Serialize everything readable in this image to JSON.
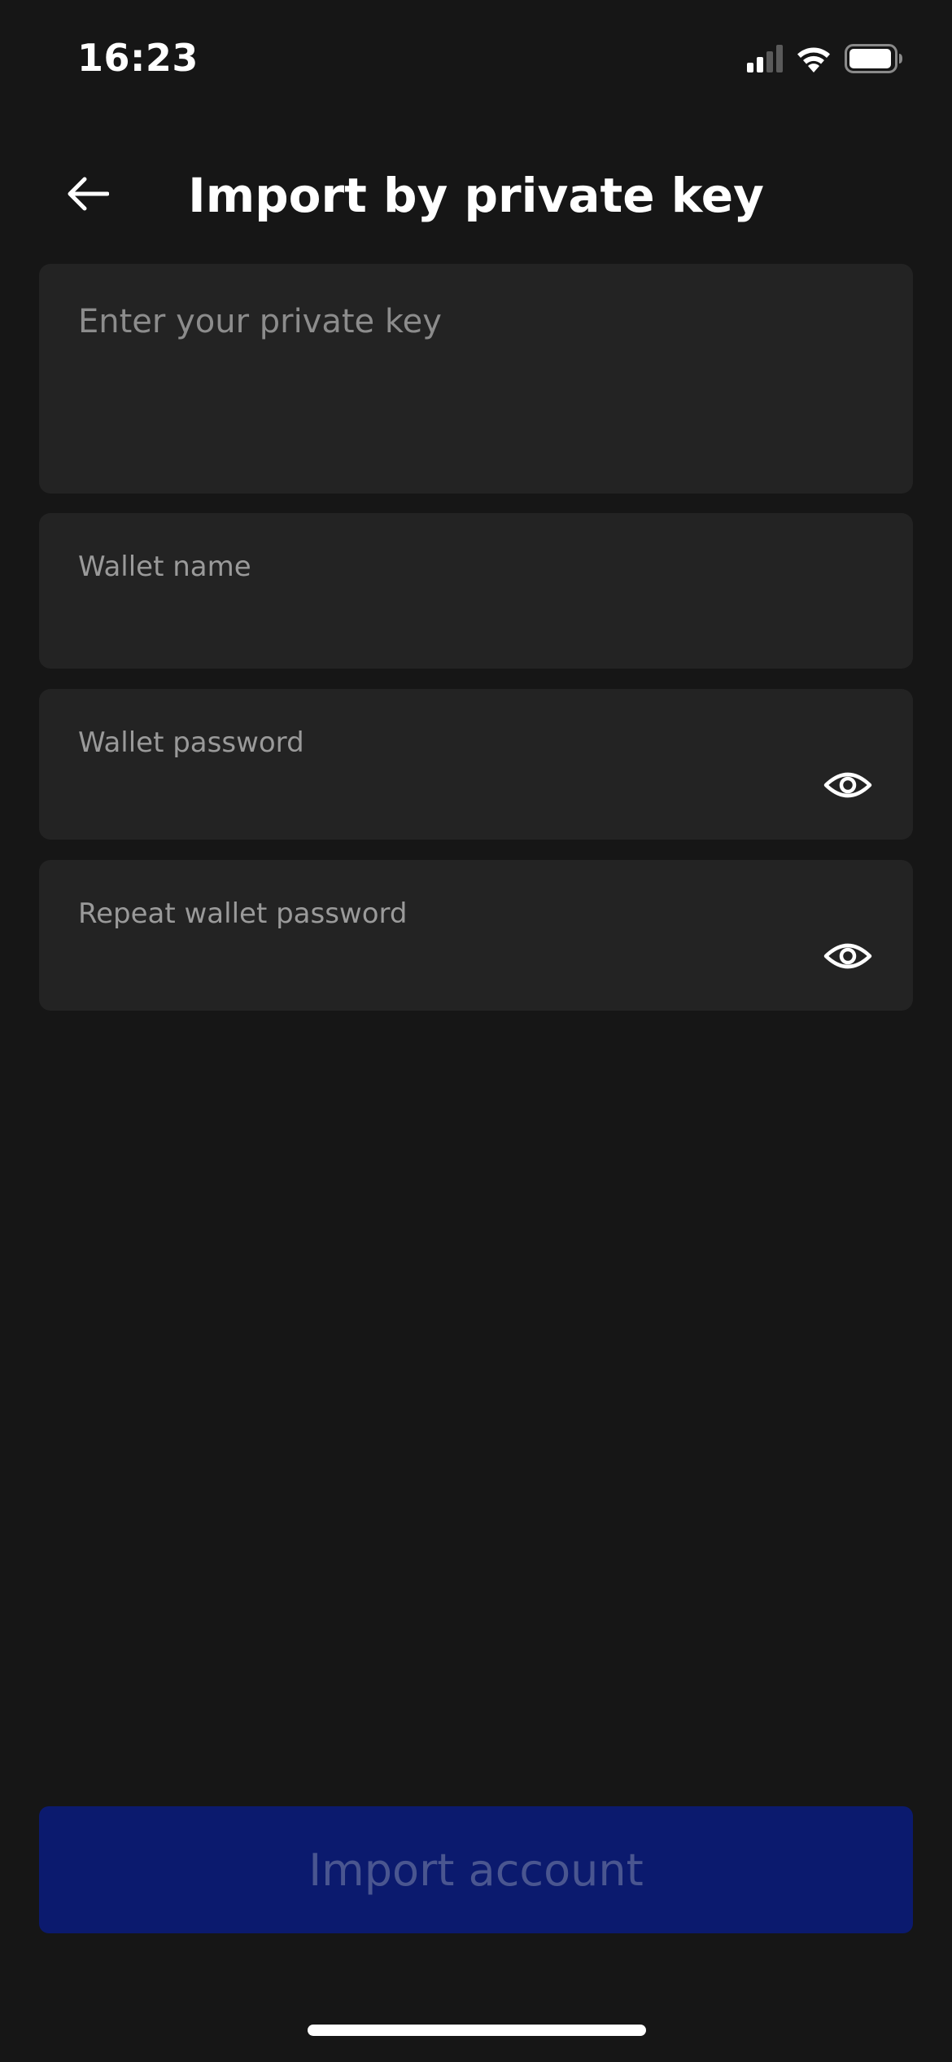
{
  "status_bar": {
    "time": "16:23",
    "icons": [
      "signal-icon",
      "wifi-icon",
      "battery-icon"
    ]
  },
  "header": {
    "title": "Import by private key",
    "back_icon": "arrow-left-icon"
  },
  "form": {
    "private_key": {
      "placeholder": "Enter your private key",
      "value": ""
    },
    "wallet_name": {
      "label": "Wallet name",
      "value": ""
    },
    "wallet_password": {
      "label": "Wallet password",
      "value": "",
      "toggle_icon": "eye-icon"
    },
    "repeat_password": {
      "label": "Repeat wallet password",
      "value": "",
      "toggle_icon": "eye-icon"
    }
  },
  "actions": {
    "import_label": "Import account"
  },
  "colors": {
    "background": "#161616",
    "field_background": "#232323",
    "button_background": "#0b1a6e",
    "button_text_disabled": "#4a5690",
    "label_text": "#9a9a9a"
  }
}
